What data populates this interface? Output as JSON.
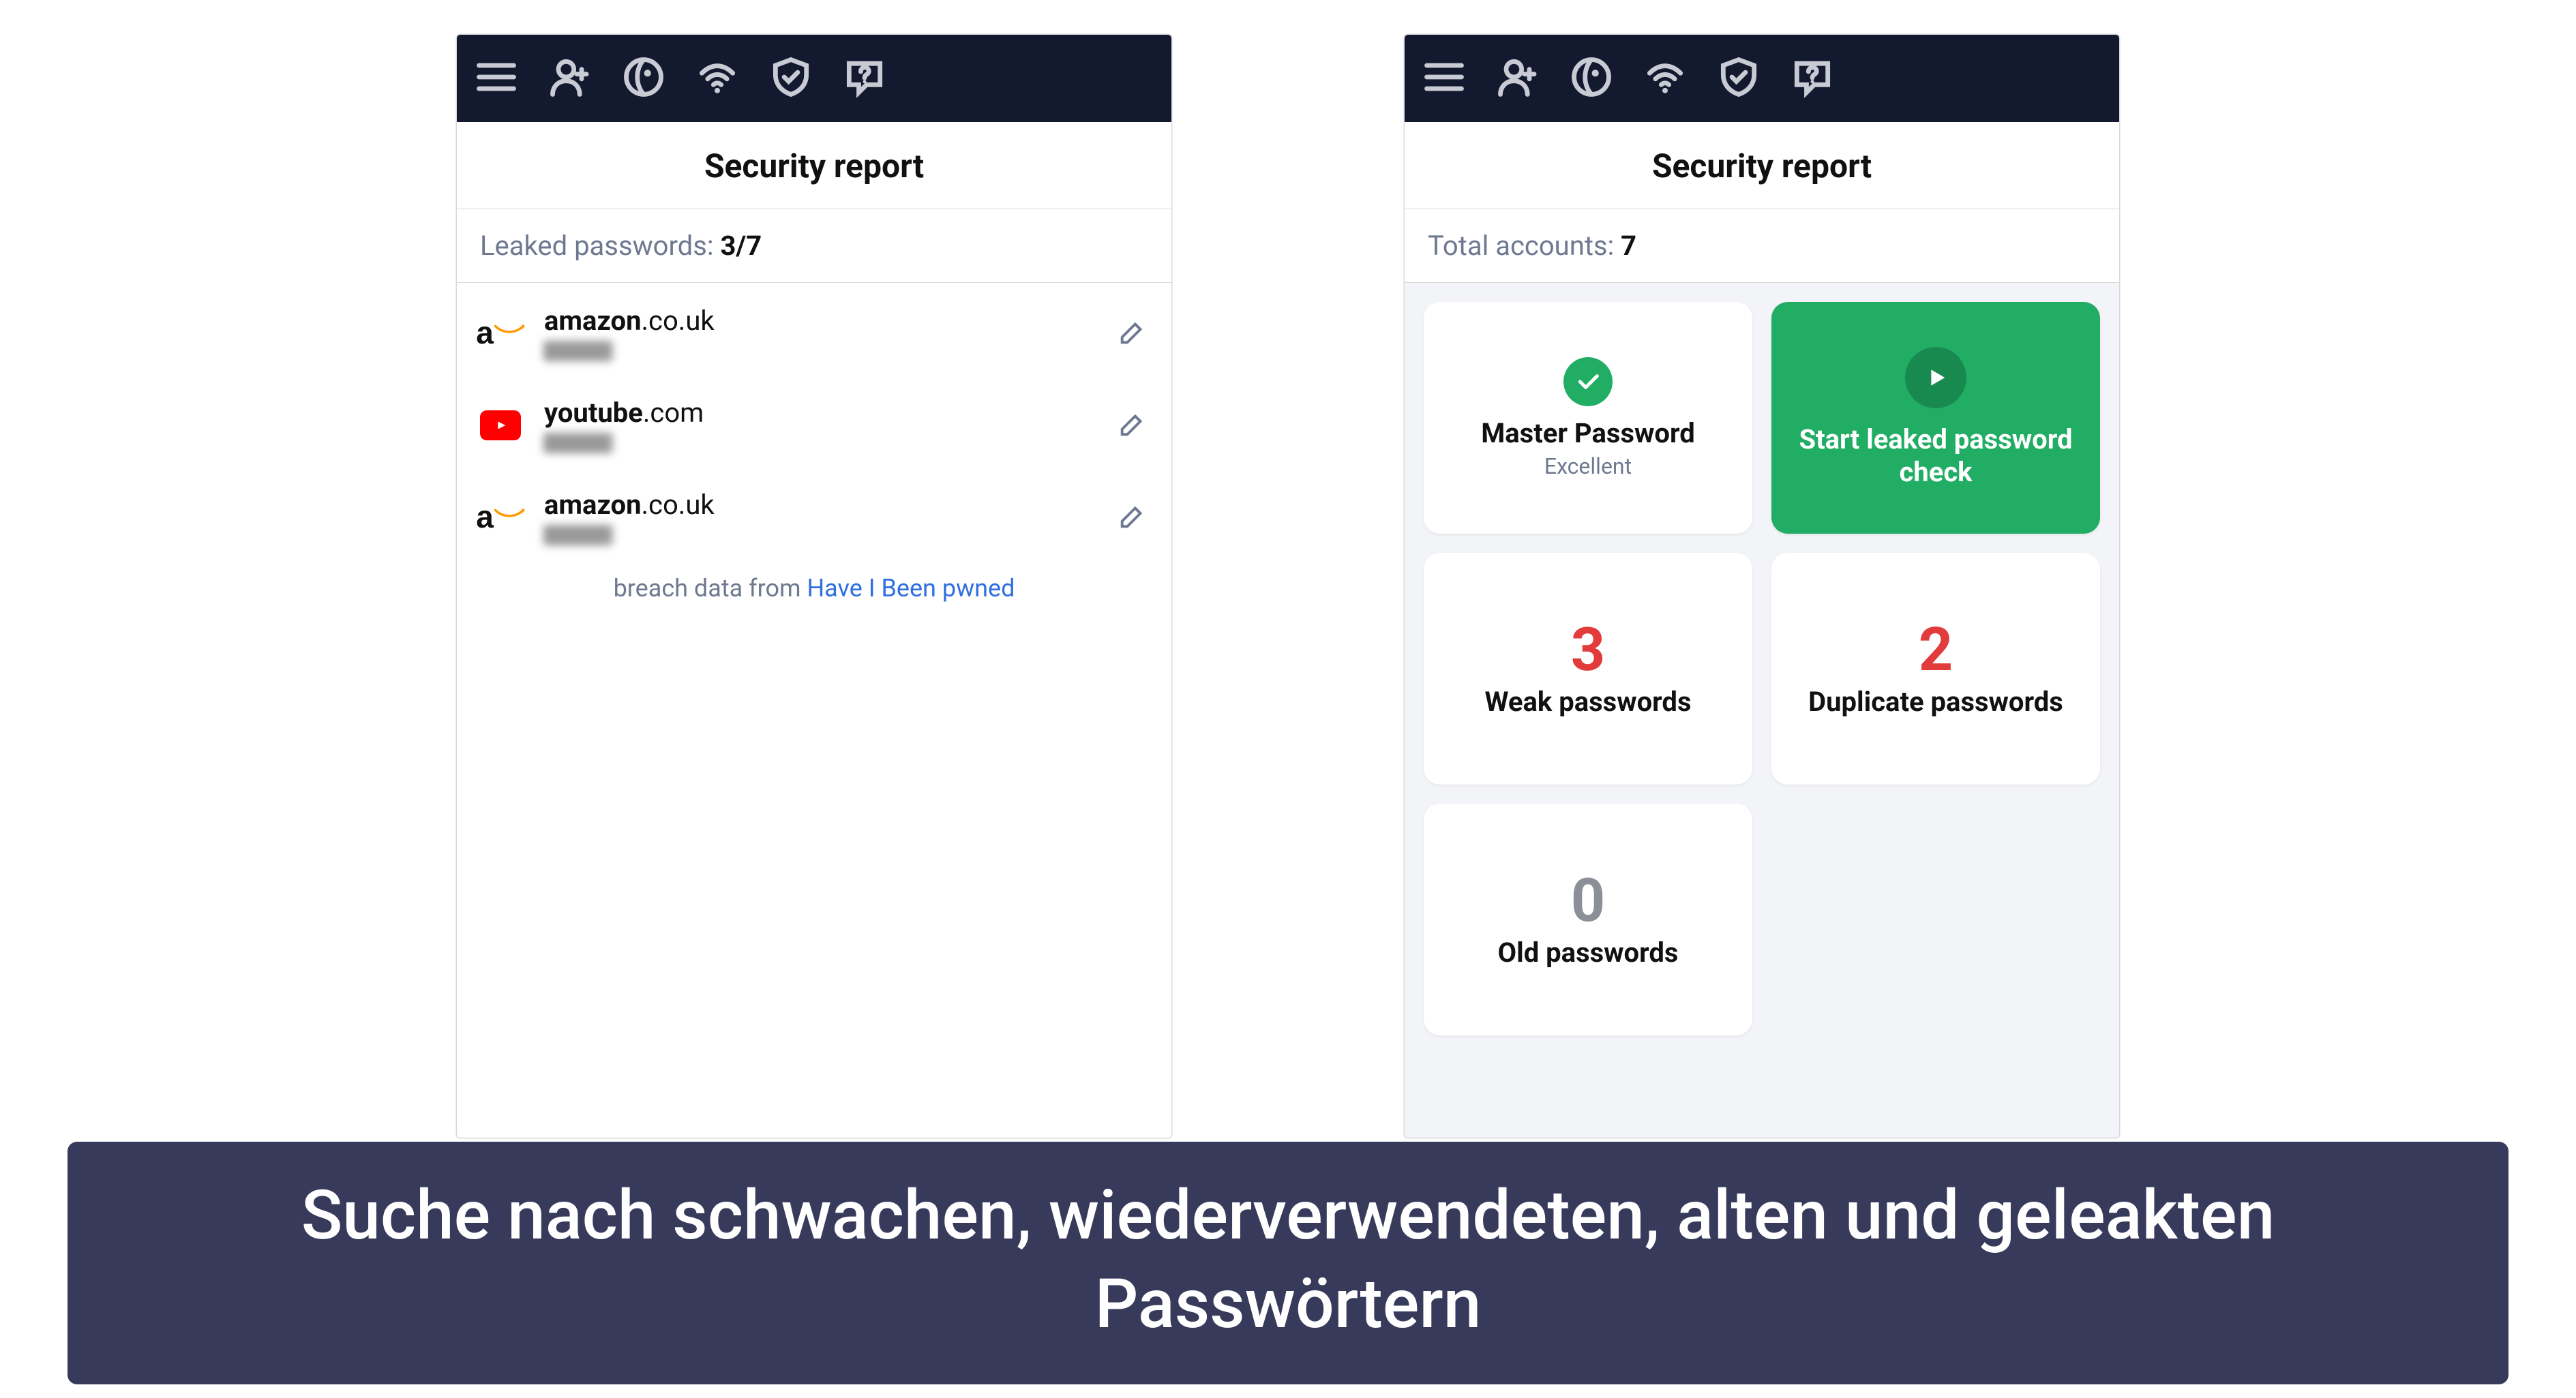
{
  "toolbar_icons": [
    "menu-icon",
    "profile-icon",
    "globe-icon",
    "wifi-icon",
    "shield-icon",
    "help-icon"
  ],
  "left": {
    "title": "Security report",
    "subheader_label": "Leaked passwords: ",
    "subheader_count": "3/7",
    "items": [
      {
        "icon": "amazon",
        "domain_bold": "amazon",
        "domain_rest": ".co.uk"
      },
      {
        "icon": "youtube",
        "domain_bold": "youtube",
        "domain_rest": ".com"
      },
      {
        "icon": "amazon",
        "domain_bold": "amazon",
        "domain_rest": ".co.uk"
      }
    ],
    "breach_prefix": "breach data from ",
    "breach_link": "Have I Been pwned"
  },
  "right": {
    "title": "Security report",
    "subheader_label": "Total accounts: ",
    "subheader_count": "7",
    "cards": {
      "master": {
        "title": "Master Password",
        "sub": "Excellent"
      },
      "start": {
        "title": "Start leaked password check"
      },
      "weak": {
        "num": "3",
        "label": "Weak passwords"
      },
      "dup": {
        "num": "2",
        "label": "Duplicate passwords"
      },
      "old": {
        "num": "0",
        "label": "Old passwords"
      }
    }
  },
  "banner": "Suche nach schwachen, wiederverwendeten, alten und geleakten Passwörtern"
}
